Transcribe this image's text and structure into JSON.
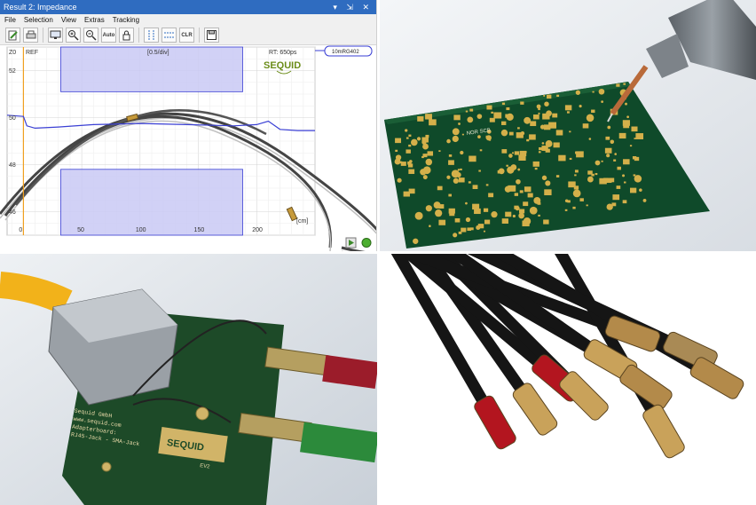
{
  "app": {
    "title": "Result 2: Impedance",
    "title_icons": "▾ ⇲ ✕",
    "menu": [
      "File",
      "Selection",
      "View",
      "Extras",
      "Tracking"
    ],
    "toolbar": {
      "auto_label": "Auto",
      "clr_label": "CLR"
    },
    "plot": {
      "ref_label": "REF",
      "z0_label": "Z0",
      "scale_label": "[0.5/div]",
      "rise_time": "RT: 650ps",
      "brand": "SEQUID",
      "trace_tag": "10mRG402",
      "x_unit": "[cm]",
      "y_ticks": [
        "52",
        "50",
        "48",
        "46"
      ],
      "x_ticks": [
        "0",
        "50",
        "100",
        "150",
        "200"
      ]
    },
    "colors": {
      "titlebar": "#2f6cc0",
      "trace": "#3a3fd4",
      "band": "#c9c9f5",
      "ref_line": "#f0a020",
      "brand": "#6c8d1a"
    }
  },
  "chart_data": {
    "type": "line",
    "title": "",
    "xlabel": "[cm]",
    "ylabel": "",
    "xlim": [
      -14,
      250
    ],
    "ylim": [
      45,
      53
    ],
    "series": [
      {
        "name": "10mRG402",
        "x": [
          -14,
          0,
          3,
          10,
          30,
          60,
          100,
          140,
          180,
          200,
          210,
          220,
          235,
          250
        ],
        "y": [
          50.1,
          50.05,
          49.65,
          49.55,
          49.6,
          49.7,
          49.75,
          49.7,
          49.65,
          49.7,
          49.85,
          49.5,
          49.45,
          49.45
        ]
      }
    ],
    "tolerance_bands": [
      {
        "x": [
          32,
          188
        ],
        "y": [
          51.1,
          53
        ]
      },
      {
        "x": [
          32,
          188
        ],
        "y": [
          45,
          47.8
        ]
      }
    ]
  },
  "pcb_photo": {
    "board_label": "NOR SCB"
  },
  "adapter_photo": {
    "brand": "SEQUID",
    "lines": [
      "Sequid GmbH",
      "www.sequid.com",
      "Adapterboard:",
      "RJ45-Jack - SMA-Jack"
    ],
    "version": "EV2"
  }
}
